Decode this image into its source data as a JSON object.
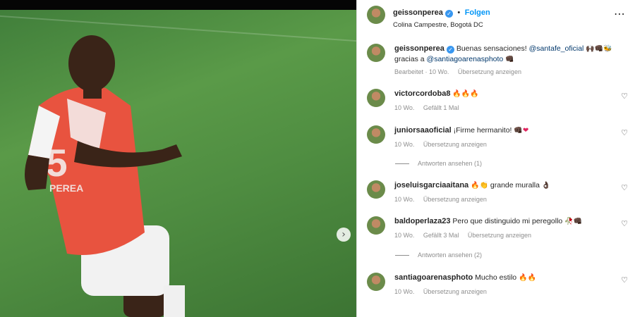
{
  "post": {
    "username": "geissonperea",
    "follow_label": "Folgen",
    "location": "Colina Campestre, Bogotá DC",
    "more_icon": "⋯",
    "next_icon": "›"
  },
  "caption": {
    "username": "geissonperea",
    "text_before": "Buenas sensaciones!",
    "mention1": "@santafe_oficial",
    "emoji1": "🙌🏿👊🏿🐝",
    "text_mid": "gracias a",
    "mention2": "@santiagoarenasphoto",
    "emoji2": "👊🏿",
    "edited": "Bearbeitet · 10 Wo.",
    "translate": "Übersetzung anzeigen"
  },
  "comments": [
    {
      "username": "victorcordoba8",
      "text": "",
      "emoji": "🔥🔥🔥",
      "time": "10 Wo.",
      "action": "Gefällt 1 Mal"
    },
    {
      "username": "juniorsaaoficial",
      "text": "¡Firme hermanito!",
      "emoji": "👊🏿❤",
      "time": "10 Wo.",
      "action": "Übersetzung anzeigen",
      "replies": "Antworten ansehen (1)"
    },
    {
      "username": "joseluisgarciaaitana",
      "text": "grande muralla",
      "emoji_before": "🔥👏",
      "emoji": "👌🏿",
      "time": "10 Wo.",
      "action": "Übersetzung anzeigen"
    },
    {
      "username": "baldoperlaza23",
      "text": "Pero que distinguido mi peregollo",
      "emoji": "🥀👊🏿",
      "time": "10 Wo.",
      "likes": "Gefällt 3 Mal",
      "action": "Übersetzung anzeigen",
      "replies": "Antworten ansehen (2)"
    },
    {
      "username": "santiagoarenasphoto",
      "text": "Mucho estilo",
      "emoji": "🔥🔥",
      "time": "10 Wo.",
      "action": "Übersetzung anzeigen"
    }
  ],
  "icons": {
    "heart": "♡",
    "verified": "✓"
  }
}
